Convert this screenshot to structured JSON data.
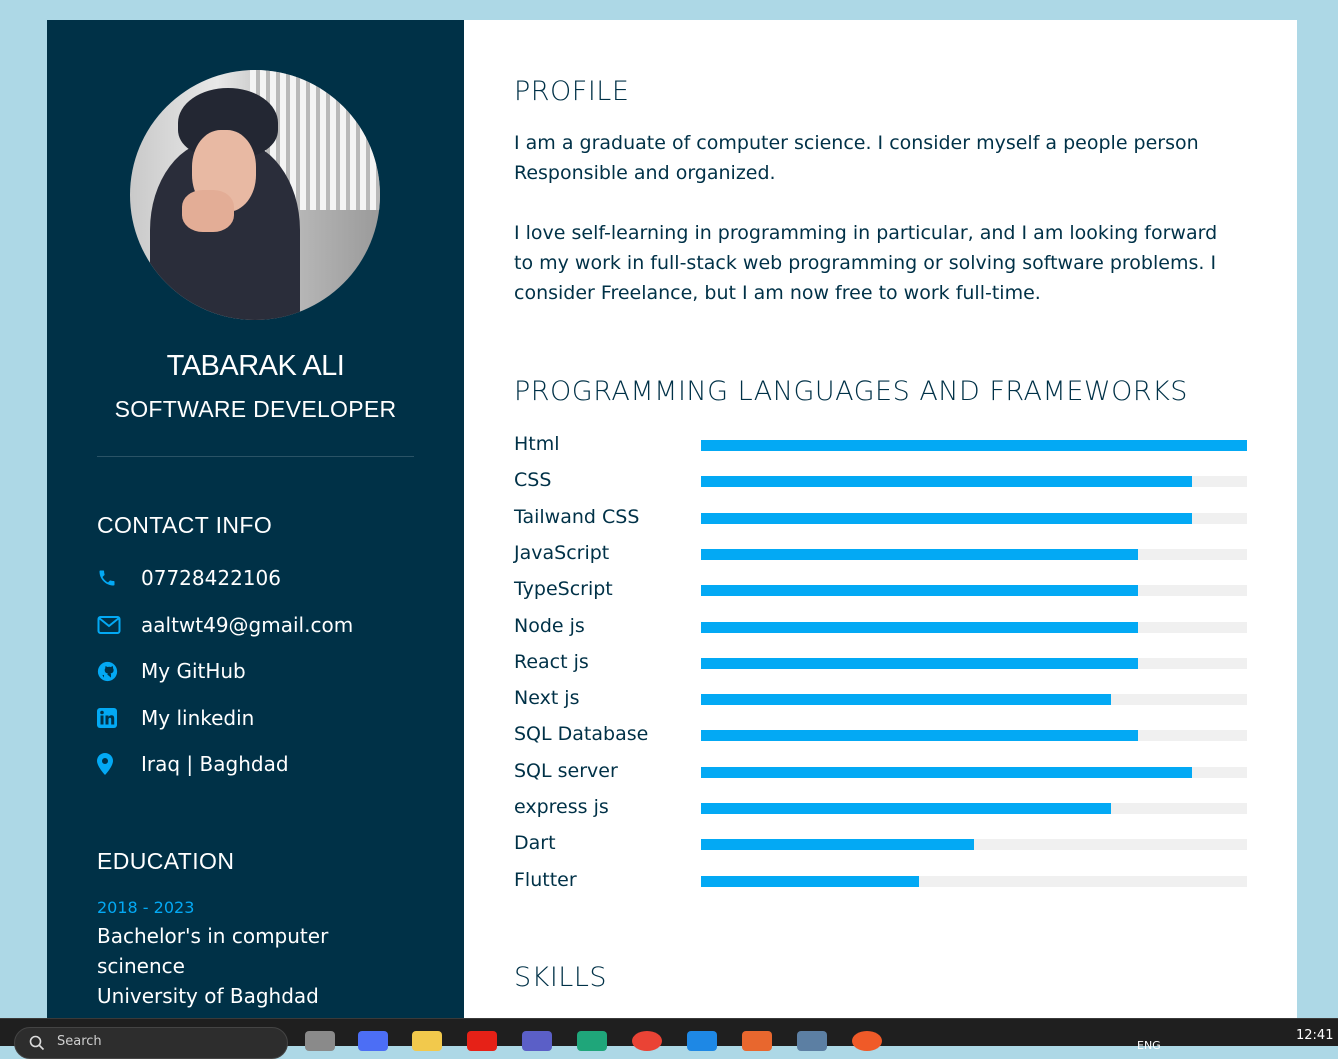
{
  "profile": {
    "name": "TABARAK ALI",
    "title": "SOFTWARE DEVELOPER"
  },
  "contact": {
    "heading": "CONTACT INFO",
    "items": [
      {
        "icon": "phone-icon",
        "text": "07728422106"
      },
      {
        "icon": "email-icon",
        "text": "aaltwt49@gmail.com"
      },
      {
        "icon": "github-icon",
        "text": "My GitHub"
      },
      {
        "icon": "linkedin-icon",
        "text": "My linkedin"
      },
      {
        "icon": "location-pin-icon",
        "text": "Iraq | Baghdad"
      }
    ]
  },
  "education": {
    "heading": "EDUCATION",
    "year": "2018 - 2023",
    "lines": [
      "Bachelor's in computer",
      "scinence",
      "University of Baghdad"
    ]
  },
  "about": {
    "heading": "PROFILE",
    "lines": [
      "I am a graduate of computer science. I consider myself a people person",
      "Responsible and organized.",
      "I love self-learning in programming in particular, and I am looking forward",
      "to my work in full-stack web programming or solving software problems. I",
      "consider Freelance, but I am now free to work full-time."
    ]
  },
  "languages": {
    "heading": "PROGRAMMING LANGUAGES AND FRAMEWORKS",
    "items": [
      {
        "label": "Html",
        "percent": 100
      },
      {
        "label": "CSS",
        "percent": 90
      },
      {
        "label": "Tailwand CSS",
        "percent": 90
      },
      {
        "label": "JavaScript",
        "percent": 80
      },
      {
        "label": "TypeScript",
        "percent": 80
      },
      {
        "label": "Node js",
        "percent": 80
      },
      {
        "label": "React js",
        "percent": 80
      },
      {
        "label": "Next js",
        "percent": 75
      },
      {
        "label": "SQL Database",
        "percent": 80
      },
      {
        "label": "SQL server",
        "percent": 90
      },
      {
        "label": "express js",
        "percent": 75
      },
      {
        "label": "Dart",
        "percent": 50
      },
      {
        "label": "Flutter",
        "percent": 40
      }
    ]
  },
  "skills": {
    "heading": "SKILLS"
  },
  "colors": {
    "sidebar": "#003147",
    "accent": "#03a9f4",
    "page_bg": "#add8e6"
  },
  "taskbar": {
    "search_placeholder": "Search",
    "lang": "ENG",
    "time": "12:41"
  }
}
